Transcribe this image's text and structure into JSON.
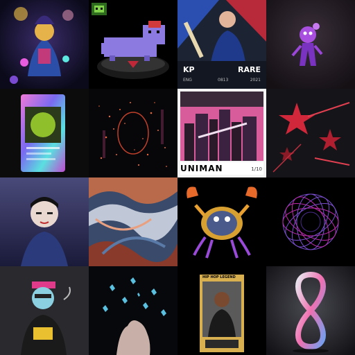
{
  "gallery": {
    "items": [
      {
        "id": "tile-1",
        "label": ""
      },
      {
        "id": "tile-2",
        "label": ""
      },
      {
        "id": "tile-3",
        "label": ""
      },
      {
        "id": "tile-4",
        "label": ""
      },
      {
        "id": "tile-5",
        "label": ""
      },
      {
        "id": "tile-6",
        "label": ""
      },
      {
        "id": "tile-7",
        "label": ""
      },
      {
        "id": "tile-8",
        "label": ""
      },
      {
        "id": "tile-9",
        "label": ""
      },
      {
        "id": "tile-10",
        "label": ""
      },
      {
        "id": "tile-11",
        "label": ""
      },
      {
        "id": "tile-12",
        "label": ""
      },
      {
        "id": "tile-13",
        "label": ""
      },
      {
        "id": "tile-14",
        "label": ""
      },
      {
        "id": "tile-15",
        "label": ""
      },
      {
        "id": "tile-16",
        "label": ""
      }
    ]
  },
  "cricket_card": {
    "initials": "KP",
    "rarity": "RARE",
    "col1": "ENG",
    "col2": "0813",
    "col3": "2021"
  },
  "comic": {
    "title": "UNIMAN",
    "issue": "1/10"
  },
  "music_card": {
    "title": "HIP HOP LEGEND"
  },
  "colors": {
    "background": "#000000",
    "purple": "#7b4fd0",
    "magenta": "#c02bb0",
    "red": "#d0273a"
  },
  "icons": {
    "alien": "alien-icon",
    "infinity": "infinity-icon"
  }
}
